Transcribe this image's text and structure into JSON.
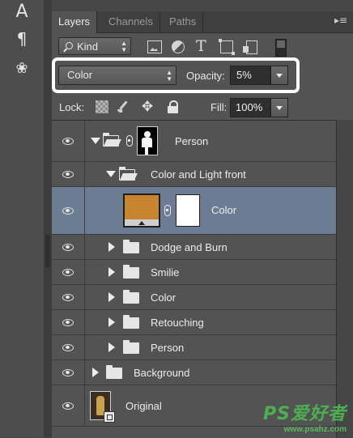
{
  "tools": {
    "type_tool_glyph": "A",
    "paragraph_glyph": "¶",
    "brush_tool_glyph": "❀"
  },
  "tabs": [
    "Layers",
    "Channels",
    "Paths"
  ],
  "panel_menu_glyph": "▸≡",
  "filter": {
    "kind_label": "Kind",
    "icons": [
      "image-filter-icon",
      "adjustment-filter-icon",
      "type-filter-icon",
      "shape-filter-icon",
      "smart-object-filter-icon",
      "filter-toggle-switch"
    ]
  },
  "blend": {
    "mode": "Color",
    "opacity_label": "Opacity:",
    "opacity_value": "5%"
  },
  "lock": {
    "label": "Lock:",
    "fill_label": "Fill:",
    "fill_value": "100%"
  },
  "layers": [
    {
      "name": "Person",
      "type": "group-open-masked",
      "level": 0
    },
    {
      "name": "Color and Light front",
      "type": "group-open",
      "level": 1
    },
    {
      "name": "Color",
      "type": "fill-layer",
      "level": 2,
      "selected": true,
      "fill_color": "#c8842e"
    },
    {
      "name": "Dodge and Burn",
      "type": "group",
      "level": 1
    },
    {
      "name": "Smilie",
      "type": "group",
      "level": 1
    },
    {
      "name": "Color",
      "type": "group",
      "level": 1
    },
    {
      "name": "Retouching",
      "type": "group",
      "level": 1
    },
    {
      "name": "Person",
      "type": "group",
      "level": 1
    },
    {
      "name": "Background",
      "type": "group",
      "level": 0
    },
    {
      "name": "Original",
      "type": "smart-object",
      "level": 0
    }
  ],
  "watermark": {
    "brand": "PS爱好者",
    "url": "www.psahz.com"
  },
  "colors": {
    "panel_bg": "#535353",
    "selected_row": "#6c7d93",
    "fill_swatch": "#c8842e",
    "highlight_box": "#ffffff",
    "watermark_green": "#4caf50"
  }
}
